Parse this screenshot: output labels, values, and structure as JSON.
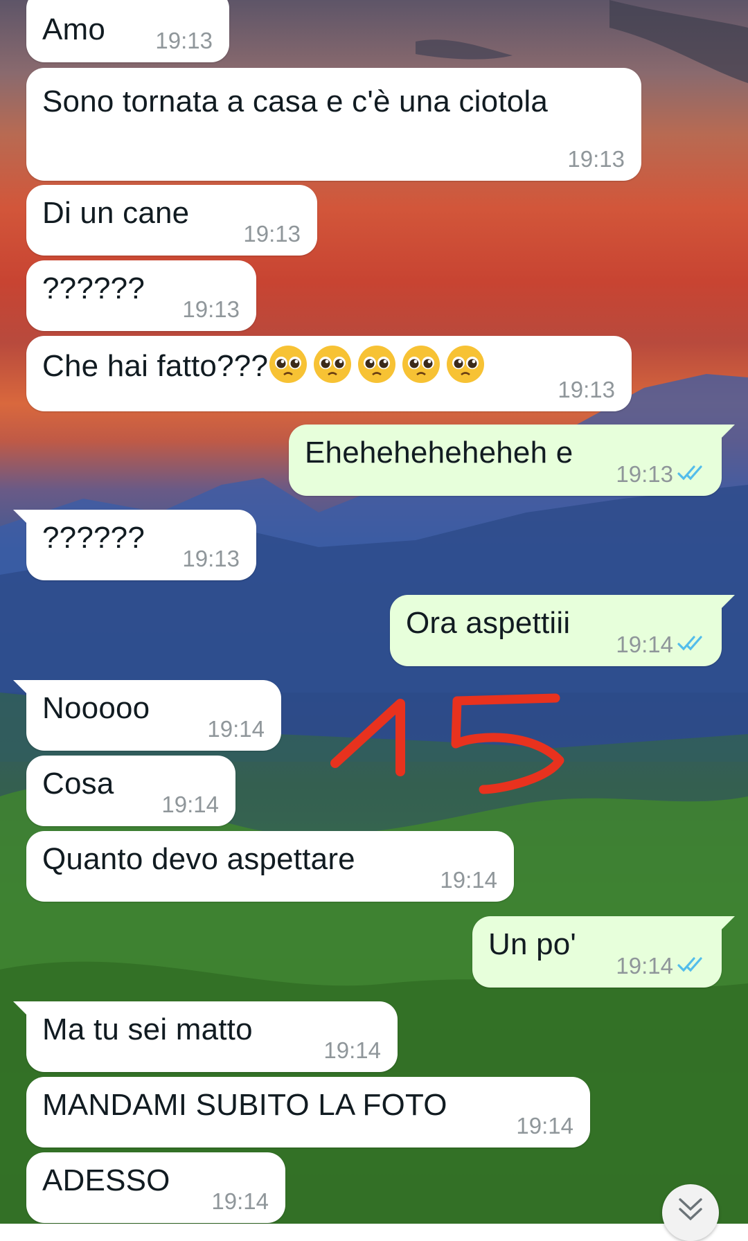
{
  "colors": {
    "incoming_bubble": "#ffffff",
    "outgoing_bubble": "#e7ffdb",
    "read_ticks": "#53bdeb",
    "annotation_red": "#e8321e"
  },
  "annotation_text": "15",
  "messages": [
    {
      "direction": "incoming",
      "text": "Amo",
      "time": "19:13"
    },
    {
      "direction": "incoming",
      "text": "Sono tornata a casa e c'è una ciotola",
      "time": "19:13"
    },
    {
      "direction": "incoming",
      "text": "Di un cane",
      "time": "19:13"
    },
    {
      "direction": "incoming",
      "text": "??????",
      "time": "19:13"
    },
    {
      "direction": "incoming",
      "text": "Che hai fatto???",
      "emoji": "pleading-face-emoji x5",
      "time": "19:13"
    },
    {
      "direction": "outgoing",
      "text": "Eheheheheheheh e",
      "time": "19:13",
      "status": "read"
    },
    {
      "direction": "incoming",
      "text": "??????",
      "time": "19:13"
    },
    {
      "direction": "outgoing",
      "text": "Ora aspettiii",
      "time": "19:14",
      "status": "read"
    },
    {
      "direction": "incoming",
      "text": "Nooooo",
      "time": "19:14"
    },
    {
      "direction": "incoming",
      "text": "Cosa",
      "time": "19:14"
    },
    {
      "direction": "incoming",
      "text": "Quanto devo aspettare",
      "time": "19:14"
    },
    {
      "direction": "outgoing",
      "text": "Un po'",
      "time": "19:14",
      "status": "read"
    },
    {
      "direction": "incoming",
      "text": "Ma tu sei matto",
      "time": "19:14"
    },
    {
      "direction": "incoming",
      "text": "MANDAMI SUBITO LA FOTO",
      "time": "19:14"
    },
    {
      "direction": "incoming",
      "text": "ADESSO",
      "time": "19:14"
    }
  ],
  "scroll_button_icon": "double-chevron-down-icon"
}
